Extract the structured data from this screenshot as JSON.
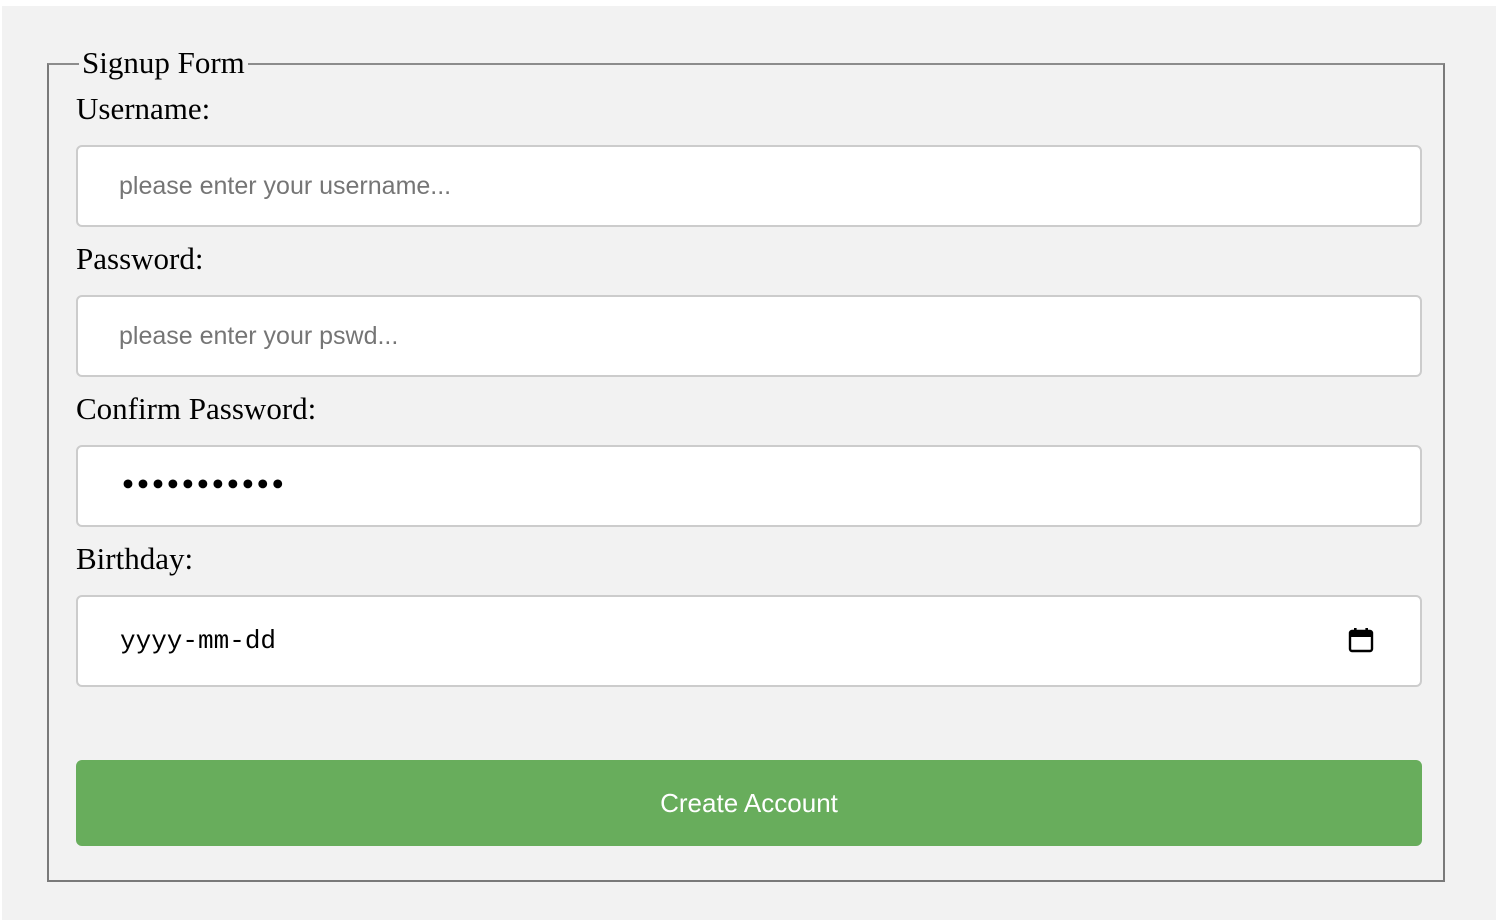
{
  "form": {
    "legend": "Signup Form",
    "username": {
      "label": "Username:",
      "placeholder": "please enter your username..."
    },
    "password": {
      "label": "Password:",
      "placeholder": "please enter your pswd..."
    },
    "confirm_password": {
      "label": "Confirm Password:",
      "masked_value": "•••••••••••"
    },
    "birthday": {
      "label": "Birthday:",
      "placeholder": "yyyy-mm-dd",
      "icon": "calendar-icon"
    },
    "submit_label": "Create Account"
  },
  "colors": {
    "background": "#f2f2f2",
    "button": "#68ad5c",
    "button_text": "#ffffff",
    "input_border": "#cccccc",
    "placeholder": "#757575"
  }
}
